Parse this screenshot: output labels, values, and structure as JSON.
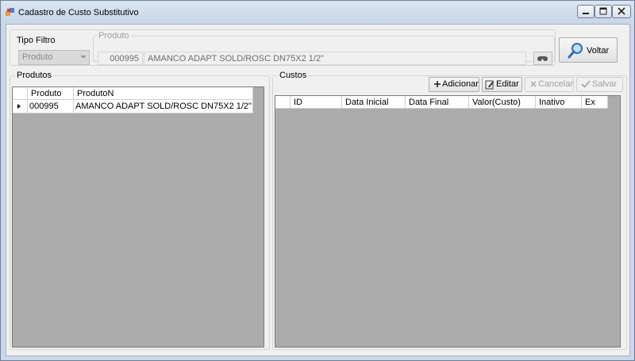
{
  "window": {
    "title": "Cadastro de Custo Substitutivo"
  },
  "filter": {
    "tipo_label": "Tipo Filtro",
    "tipo_value": "Produto",
    "produto_label": "Produto",
    "produto_code": "000995",
    "produto_desc": "AMANCO ADAPT SOLD/ROSC DN75X2 1/2\""
  },
  "actions": {
    "voltar": "Voltar"
  },
  "produtos": {
    "label": "Produtos",
    "columns": [
      "Produto",
      "ProdutoN"
    ],
    "rows": [
      {
        "code": "000995",
        "name": "AMANCO ADAPT SOLD/ROSC DN75X2 1/2\""
      }
    ]
  },
  "custos": {
    "label": "Custos",
    "buttons": {
      "add": "Adicionar",
      "edit": "Editar",
      "cancel": "Cancelar",
      "save": "Salvar"
    },
    "columns": [
      "ID",
      "Data Inicial",
      "Data Final",
      "Valor(Custo)",
      "Inativo",
      "Ex"
    ]
  },
  "icons": {
    "app": "app-icon",
    "search": "magnifier-icon",
    "lookup": "binoculars-icon",
    "add": "plus-icon",
    "edit": "edit-icon",
    "cancel": "x-icon",
    "save": "check-icon",
    "row_selector": "current-row-arrow-icon"
  }
}
